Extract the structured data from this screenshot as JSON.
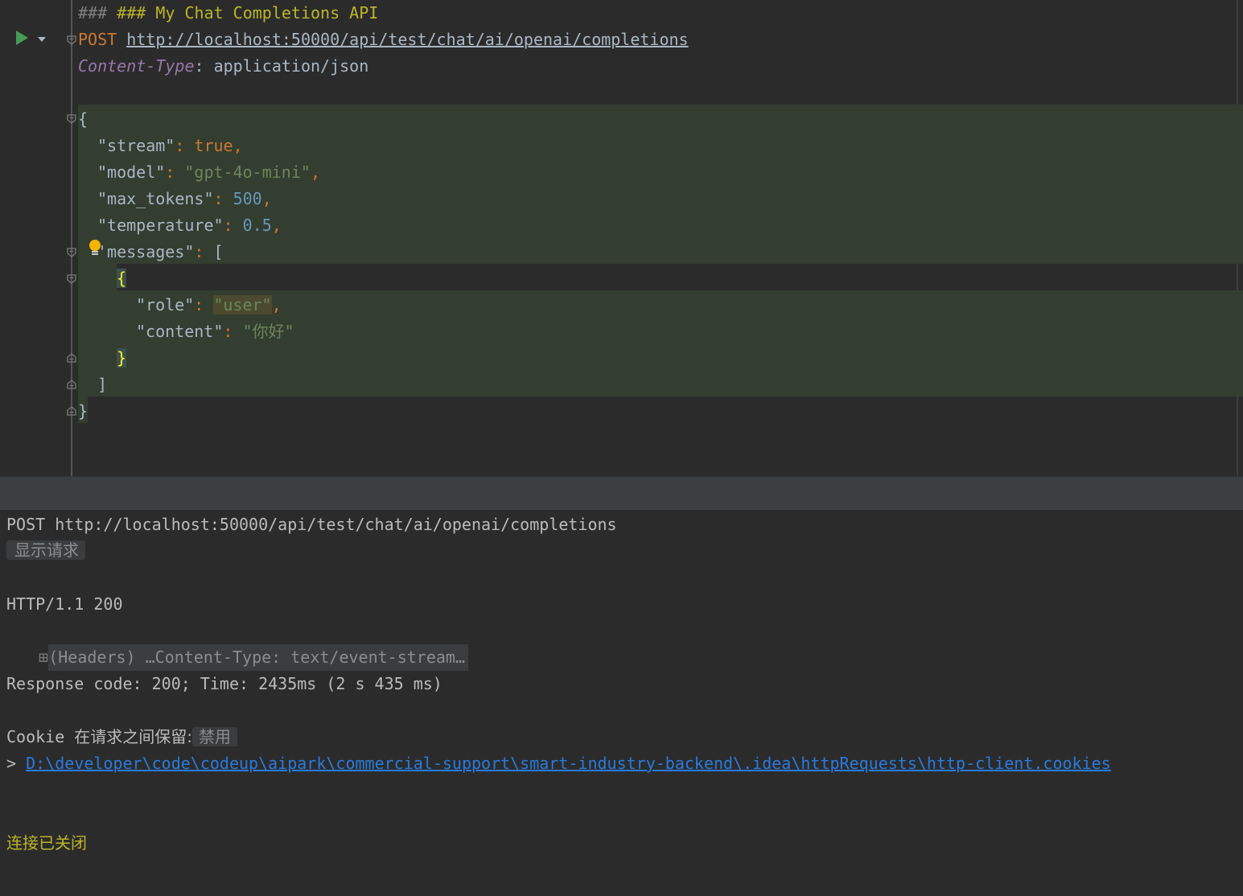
{
  "editor": {
    "comment": "### My Chat Completions API",
    "method": "POST",
    "url": "http://localhost:50000/api/test/chat/ai/openai/completions",
    "header_name": "Content-Type",
    "header_sep": ": ",
    "header_value": "application/json",
    "body": {
      "open_brace": "{",
      "close_brace": "}",
      "k_stream": "\"stream\"",
      "v_stream": "true",
      "k_model": "\"model\"",
      "v_model": "\"gpt-4o-mini\"",
      "k_max_tokens": "\"max_tokens\"",
      "v_max_tokens": "500",
      "k_temperature": "\"temperature\"",
      "v_temperature": "0.5",
      "k_messages": "'messages\"",
      "open_bracket": "[",
      "close_bracket": "]",
      "msg_open": "{",
      "msg_close": "}",
      "k_role": "\"role\"",
      "v_role": "\"user\"",
      "k_content": "\"content\"",
      "v_content": "\"你好\""
    },
    "icons": {
      "run": "run-icon",
      "run_menu": "chevron-down-icon",
      "intention": "lightbulb-icon"
    },
    "colors": {
      "keyword": "#cc7832",
      "string": "#6a8759",
      "number": "#6897bb",
      "header": "#9876aa",
      "run": "#499c54"
    }
  },
  "console": {
    "request_line": "POST http://localhost:50000/api/test/chat/ai/openai/completions",
    "show_request_button": "显示请求",
    "status_line": "HTTP/1.1 200",
    "headers_collapsed": "(Headers) …Content-Type: text/event-stream…",
    "response_summary": "Response code: 200; Time: 2435ms (2 s 435 ms)",
    "cookie_label": "Cookie",
    "cookie_text": "在请求之间保留:",
    "cookie_state": "禁用",
    "cookie_prompt": "> ",
    "cookie_path": "D:\\developer\\code\\codeup\\aipark\\commercial-support\\smart-industry-backend\\.idea\\httpRequests\\http-client.cookies",
    "connection_closed": "连接已关闭",
    "colors": {
      "link": "#287bde",
      "closed": "#bbb529"
    }
  }
}
